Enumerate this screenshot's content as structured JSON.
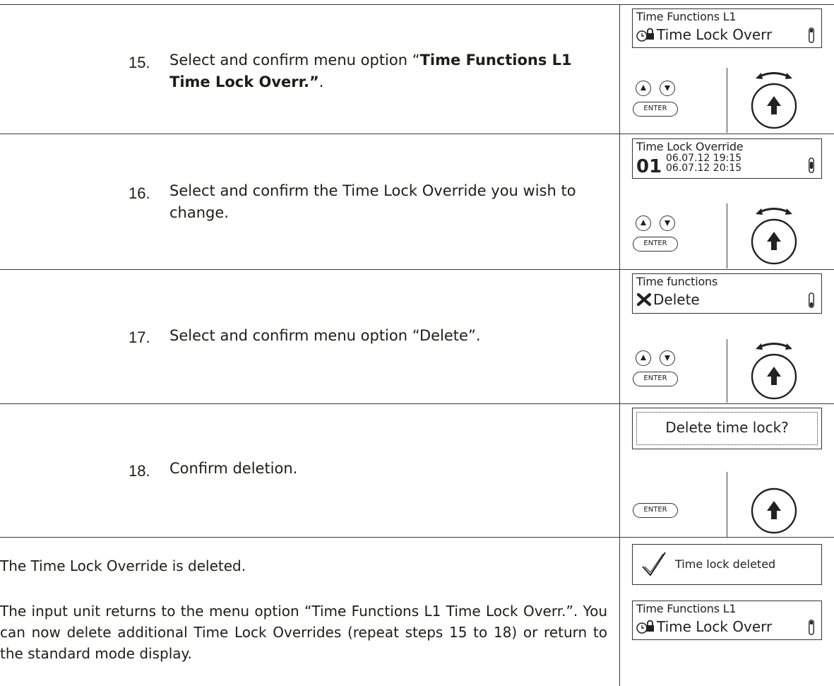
{
  "steps": [
    {
      "number": "15.",
      "text_before": "Select and confirm menu option “",
      "text_bold": "Time Functions L1 Time Lock Overr.”",
      "text_after": ".",
      "lcd": {
        "top": "Time Functions L1",
        "bottom": "Time Lock Overr",
        "icon": "clock-lock-icon"
      },
      "keys": {
        "up": true,
        "down": true,
        "enter_label": "ENTER"
      }
    },
    {
      "number": "16.",
      "text": "Select and confirm the Time Lock Override you wish to change.",
      "lcd": {
        "top": "Time Lock Override",
        "entry_number": "01",
        "start": "06.07.12 19:15",
        "end": "06.07.12 20:15"
      },
      "keys": {
        "up": true,
        "down": true,
        "enter_label": "ENTER"
      }
    },
    {
      "number": "17.",
      "text": "Select and confirm menu option “Delete”.",
      "lcd": {
        "top": "Time functions",
        "bottom": "Delete",
        "icon": "delete-x-icon"
      },
      "keys": {
        "up": true,
        "down": true,
        "enter_label": "ENTER"
      }
    },
    {
      "number": "18.",
      "text": "Confirm deletion.",
      "lcd": {
        "prompt": "Delete time lock?"
      },
      "keys": {
        "enter_label": "ENTER"
      }
    }
  ],
  "result": {
    "deleted_text": "The Time Lock Override is deleted.",
    "deleted_lcd": "Time lock deleted",
    "return_text": "The input unit returns to the menu option “Time Functions L1 Time Lock Overr.”. You can now delete additional Time Lock Overrides (repeat steps 15 to 18) or return to the standard mode display.",
    "return_lcd": {
      "top": "Time Functions L1",
      "bottom": "Time Lock Overr"
    }
  }
}
